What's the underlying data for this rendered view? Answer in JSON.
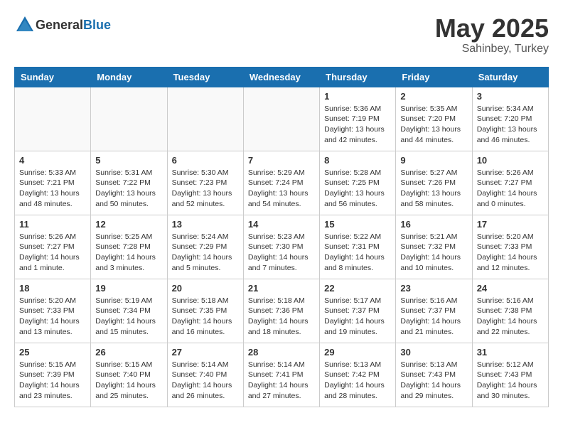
{
  "header": {
    "logo_general": "General",
    "logo_blue": "Blue",
    "month_year": "May 2025",
    "location": "Sahinbey, Turkey"
  },
  "weekdays": [
    "Sunday",
    "Monday",
    "Tuesday",
    "Wednesday",
    "Thursday",
    "Friday",
    "Saturday"
  ],
  "weeks": [
    [
      {
        "day": "",
        "info": ""
      },
      {
        "day": "",
        "info": ""
      },
      {
        "day": "",
        "info": ""
      },
      {
        "day": "",
        "info": ""
      },
      {
        "day": "1",
        "info": "Sunrise: 5:36 AM\nSunset: 7:19 PM\nDaylight: 13 hours\nand 42 minutes."
      },
      {
        "day": "2",
        "info": "Sunrise: 5:35 AM\nSunset: 7:20 PM\nDaylight: 13 hours\nand 44 minutes."
      },
      {
        "day": "3",
        "info": "Sunrise: 5:34 AM\nSunset: 7:20 PM\nDaylight: 13 hours\nand 46 minutes."
      }
    ],
    [
      {
        "day": "4",
        "info": "Sunrise: 5:33 AM\nSunset: 7:21 PM\nDaylight: 13 hours\nand 48 minutes."
      },
      {
        "day": "5",
        "info": "Sunrise: 5:31 AM\nSunset: 7:22 PM\nDaylight: 13 hours\nand 50 minutes."
      },
      {
        "day": "6",
        "info": "Sunrise: 5:30 AM\nSunset: 7:23 PM\nDaylight: 13 hours\nand 52 minutes."
      },
      {
        "day": "7",
        "info": "Sunrise: 5:29 AM\nSunset: 7:24 PM\nDaylight: 13 hours\nand 54 minutes."
      },
      {
        "day": "8",
        "info": "Sunrise: 5:28 AM\nSunset: 7:25 PM\nDaylight: 13 hours\nand 56 minutes."
      },
      {
        "day": "9",
        "info": "Sunrise: 5:27 AM\nSunset: 7:26 PM\nDaylight: 13 hours\nand 58 minutes."
      },
      {
        "day": "10",
        "info": "Sunrise: 5:26 AM\nSunset: 7:27 PM\nDaylight: 14 hours\nand 0 minutes."
      }
    ],
    [
      {
        "day": "11",
        "info": "Sunrise: 5:26 AM\nSunset: 7:27 PM\nDaylight: 14 hours\nand 1 minute."
      },
      {
        "day": "12",
        "info": "Sunrise: 5:25 AM\nSunset: 7:28 PM\nDaylight: 14 hours\nand 3 minutes."
      },
      {
        "day": "13",
        "info": "Sunrise: 5:24 AM\nSunset: 7:29 PM\nDaylight: 14 hours\nand 5 minutes."
      },
      {
        "day": "14",
        "info": "Sunrise: 5:23 AM\nSunset: 7:30 PM\nDaylight: 14 hours\nand 7 minutes."
      },
      {
        "day": "15",
        "info": "Sunrise: 5:22 AM\nSunset: 7:31 PM\nDaylight: 14 hours\nand 8 minutes."
      },
      {
        "day": "16",
        "info": "Sunrise: 5:21 AM\nSunset: 7:32 PM\nDaylight: 14 hours\nand 10 minutes."
      },
      {
        "day": "17",
        "info": "Sunrise: 5:20 AM\nSunset: 7:33 PM\nDaylight: 14 hours\nand 12 minutes."
      }
    ],
    [
      {
        "day": "18",
        "info": "Sunrise: 5:20 AM\nSunset: 7:33 PM\nDaylight: 14 hours\nand 13 minutes."
      },
      {
        "day": "19",
        "info": "Sunrise: 5:19 AM\nSunset: 7:34 PM\nDaylight: 14 hours\nand 15 minutes."
      },
      {
        "day": "20",
        "info": "Sunrise: 5:18 AM\nSunset: 7:35 PM\nDaylight: 14 hours\nand 16 minutes."
      },
      {
        "day": "21",
        "info": "Sunrise: 5:18 AM\nSunset: 7:36 PM\nDaylight: 14 hours\nand 18 minutes."
      },
      {
        "day": "22",
        "info": "Sunrise: 5:17 AM\nSunset: 7:37 PM\nDaylight: 14 hours\nand 19 minutes."
      },
      {
        "day": "23",
        "info": "Sunrise: 5:16 AM\nSunset: 7:37 PM\nDaylight: 14 hours\nand 21 minutes."
      },
      {
        "day": "24",
        "info": "Sunrise: 5:16 AM\nSunset: 7:38 PM\nDaylight: 14 hours\nand 22 minutes."
      }
    ],
    [
      {
        "day": "25",
        "info": "Sunrise: 5:15 AM\nSunset: 7:39 PM\nDaylight: 14 hours\nand 23 minutes."
      },
      {
        "day": "26",
        "info": "Sunrise: 5:15 AM\nSunset: 7:40 PM\nDaylight: 14 hours\nand 25 minutes."
      },
      {
        "day": "27",
        "info": "Sunrise: 5:14 AM\nSunset: 7:40 PM\nDaylight: 14 hours\nand 26 minutes."
      },
      {
        "day": "28",
        "info": "Sunrise: 5:14 AM\nSunset: 7:41 PM\nDaylight: 14 hours\nand 27 minutes."
      },
      {
        "day": "29",
        "info": "Sunrise: 5:13 AM\nSunset: 7:42 PM\nDaylight: 14 hours\nand 28 minutes."
      },
      {
        "day": "30",
        "info": "Sunrise: 5:13 AM\nSunset: 7:43 PM\nDaylight: 14 hours\nand 29 minutes."
      },
      {
        "day": "31",
        "info": "Sunrise: 5:12 AM\nSunset: 7:43 PM\nDaylight: 14 hours\nand 30 minutes."
      }
    ]
  ]
}
